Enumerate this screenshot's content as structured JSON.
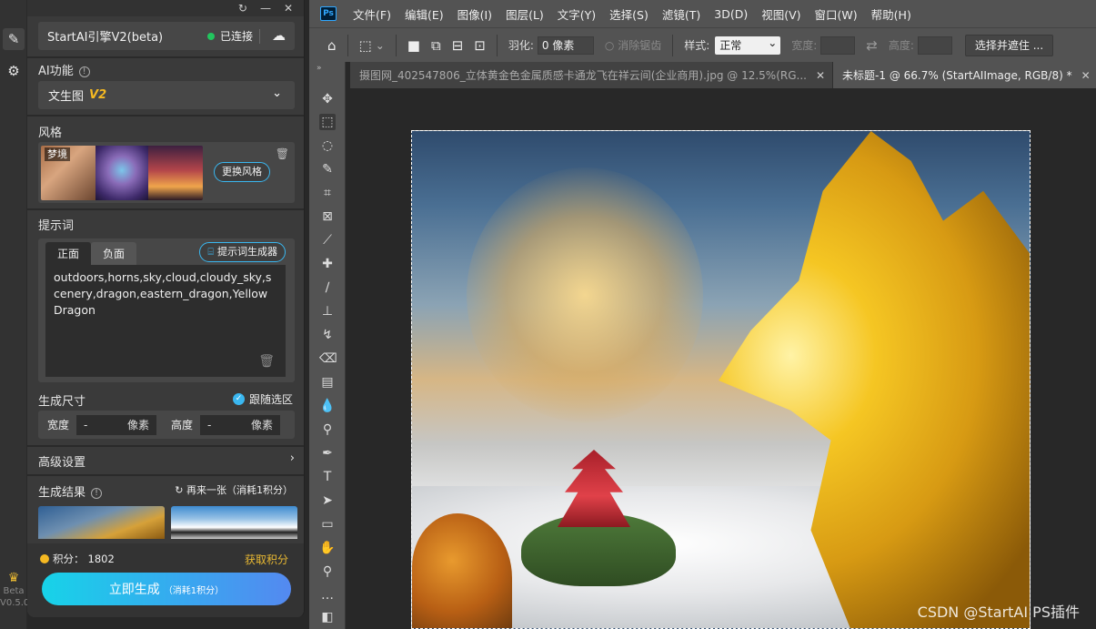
{
  "plugin": {
    "engine_name": "StartAI引擎V2(beta)",
    "status": "已连接",
    "status_color": "#22c55e",
    "accent_color": "#3ab7f0",
    "ai_function_label": "AI功能",
    "ai_function_value": "文生图",
    "ai_function_badge": "V2",
    "style_label": "风格",
    "style_name": "梦境",
    "change_style_label": "更换风格",
    "prompt_label": "提示词",
    "prompt_tabs": [
      "正面",
      "负面"
    ],
    "prompt_generator_label": "提示词生成器",
    "prompt_text": "outdoors,horns,sky,cloud,cloudy_sky,scenery,dragon,eastern_dragon,Yellow Dragon",
    "size_label": "生成尺寸",
    "follow_selection_label": "跟随选区",
    "width_label": "宽度",
    "width_value": "-",
    "height_label": "高度",
    "height_value": "-",
    "unit_label": "像素",
    "advanced_label": "高级设置",
    "results_label": "生成结果",
    "regenerate_label": "再来一张（消耗1积分）",
    "points_label": "积分：",
    "points_value": "1802",
    "get_points_label": "获取积分",
    "generate_label": "立即生成",
    "generate_cost": "（消耗1积分）",
    "rail_beta": "Beta",
    "rail_version": "V0.5.0"
  },
  "ps": {
    "menu": [
      "文件(F)",
      "编辑(E)",
      "图像(I)",
      "图层(L)",
      "文字(Y)",
      "选择(S)",
      "滤镜(T)",
      "3D(D)",
      "视图(V)",
      "窗口(W)",
      "帮助(H)"
    ],
    "options": {
      "feather_label": "羽化:",
      "feather_value": "0 像素",
      "antialias_label": "消除锯齿",
      "style_label": "样式:",
      "style_value": "正常",
      "width_label": "宽度:",
      "height_label": "高度:",
      "select_mask_label": "选择并遮住 ..."
    },
    "tabs": [
      {
        "title": "摄图网_402547806_立体黄金色金属质感卡通龙飞在祥云间(企业商用).jpg @ 12.5%(RG..."
      },
      {
        "title": "未标题-1 @ 66.7% (StartAIImage, RGB/8) *"
      }
    ],
    "watermark": "CSDN @StartAI PS插件"
  }
}
